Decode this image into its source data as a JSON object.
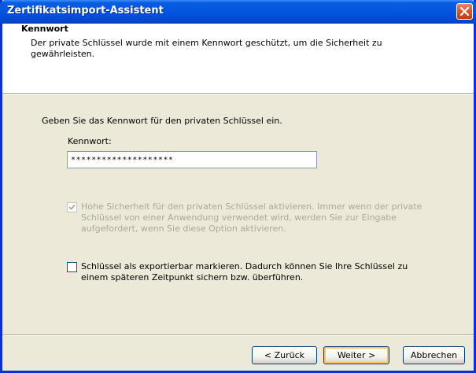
{
  "window": {
    "title": "Zertifikatsimport-Assistent"
  },
  "header": {
    "title": "Kennwort",
    "description": "Der private Schlüssel wurde mit einem Kennwort geschützt, um die Sicherheit zu gewährleisten."
  },
  "body": {
    "prompt": "Geben Sie das Kennwort für den privaten Schlüssel ein.",
    "password_label": "Kennwort:",
    "password_value": "********************",
    "high_security": {
      "label": "Hohe Sicherheit für den privaten Schlüssel aktivieren. Immer wenn der private Schlüssel von einer Anwendung verwendet wird, werden Sie zur Eingabe aufgefordert, wenn Sie diese Option aktivieren.",
      "checked": true,
      "enabled": false
    },
    "exportable": {
      "label": "Schlüssel als exportierbar markieren. Dadurch können Sie Ihre Schlüssel zu einem späteren Zeitpunkt sichern bzw. überführen.",
      "checked": false,
      "enabled": true
    }
  },
  "buttons": {
    "back": "< Zurück",
    "next": "Weiter >",
    "cancel": "Abbrechen"
  },
  "colors": {
    "titlebar": "#0456e0",
    "close": "#c43a12",
    "window_bg": "#ece9d8",
    "disabled_text": "#aca899"
  }
}
